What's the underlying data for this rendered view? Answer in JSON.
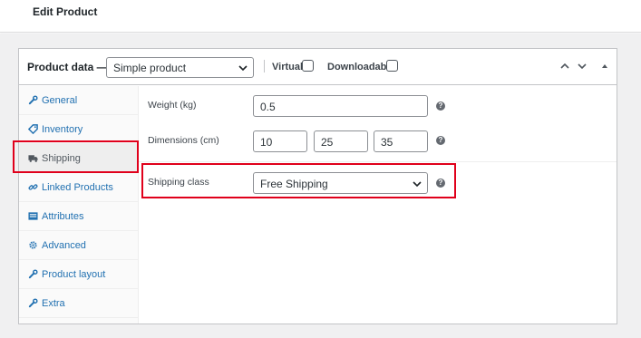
{
  "page": {
    "title": "Edit Product"
  },
  "product_data": {
    "title": "Product data —",
    "type_select": {
      "selected": "Simple product"
    },
    "virtual_label": "Virtual:",
    "downloadable_label": "Downloadable:"
  },
  "tabs": [
    {
      "label": "General",
      "icon": "wrench-icon",
      "active": false
    },
    {
      "label": "Inventory",
      "icon": "tag-icon",
      "active": false
    },
    {
      "label": "Shipping",
      "icon": "truck-icon",
      "active": true
    },
    {
      "label": "Linked Products",
      "icon": "link-icon",
      "active": false
    },
    {
      "label": "Attributes",
      "icon": "list-icon",
      "active": false
    },
    {
      "label": "Advanced",
      "icon": "gear-icon",
      "active": false
    },
    {
      "label": "Product layout",
      "icon": "wrench-icon",
      "active": false
    },
    {
      "label": "Extra",
      "icon": "wrench-icon",
      "active": false
    }
  ],
  "shipping": {
    "weight": {
      "label": "Weight (kg)",
      "value": "0.5"
    },
    "dimensions": {
      "label": "Dimensions (cm)",
      "length": "10",
      "width": "25",
      "height": "35"
    },
    "shipping_class": {
      "label": "Shipping class",
      "selected": "Free Shipping"
    },
    "help_glyph": "?"
  },
  "colors": {
    "link": "#2271b1",
    "highlight": "#e0001b",
    "active_tab_bg": "#eeeeee"
  }
}
